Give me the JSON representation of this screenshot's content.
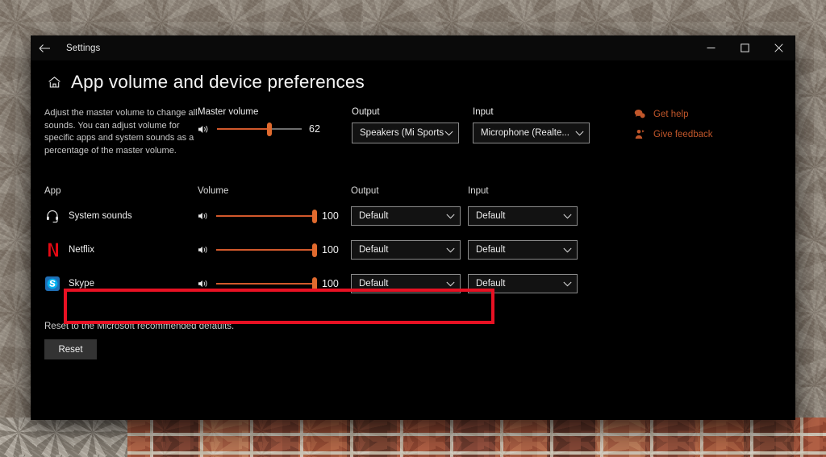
{
  "window": {
    "titlebar": {
      "back_icon": "back-arrow-icon",
      "app_title": "Settings",
      "minimize_label": "—",
      "maximize_label": "□",
      "close_label": "×"
    },
    "page": {
      "home_icon": "home-icon",
      "title": "App volume and device preferences"
    }
  },
  "top": {
    "description": "Adjust the master volume to change all sounds. You can adjust volume for specific apps and system sounds as a percentage of the master volume.",
    "master_volume": {
      "label": "Master volume",
      "icon": "speaker-icon",
      "value": 62,
      "value_text": "62",
      "min": 0,
      "max": 100
    },
    "output": {
      "label": "Output",
      "value": "Speakers (Mi Sports...",
      "chevron_icon": "chevron-down-icon"
    },
    "input": {
      "label": "Input",
      "value": "Microphone (Realte...",
      "chevron_icon": "chevron-down-icon"
    },
    "help": {
      "get_help": {
        "label": "Get help",
        "icon": "help-chat-icon"
      },
      "give_feedback": {
        "label": "Give feedback",
        "icon": "feedback-person-icon"
      },
      "link_color": "#c0562a"
    }
  },
  "table": {
    "headers": {
      "app": "App",
      "volume": "Volume",
      "output": "Output",
      "input": "Input"
    },
    "rows": [
      {
        "name": "System sounds",
        "icon": "headset-icon",
        "volume": 100,
        "volume_text": "100",
        "speaker_icon": "speaker-icon",
        "output": "Default",
        "input": "Default",
        "highlighted": false
      },
      {
        "name": "Netflix",
        "icon": "netflix-icon",
        "volume": 100,
        "volume_text": "100",
        "speaker_icon": "speaker-icon",
        "output": "Default",
        "input": "Default",
        "highlighted": true
      },
      {
        "name": "Skype",
        "icon": "skype-icon",
        "volume": 100,
        "volume_text": "100",
        "speaker_icon": "speaker-icon",
        "output": "Default",
        "input": "Default",
        "highlighted": false
      }
    ],
    "highlight_color": "#e81123"
  },
  "reset": {
    "text": "Reset to the Microsoft recommended defaults.",
    "button_label": "Reset"
  },
  "colors": {
    "window_background": "#000000",
    "accent_slider": "#d2592c",
    "slider_thumb": "#e06a2e",
    "netflix_red": "#e50914",
    "skype_blue": "#00aff0"
  }
}
